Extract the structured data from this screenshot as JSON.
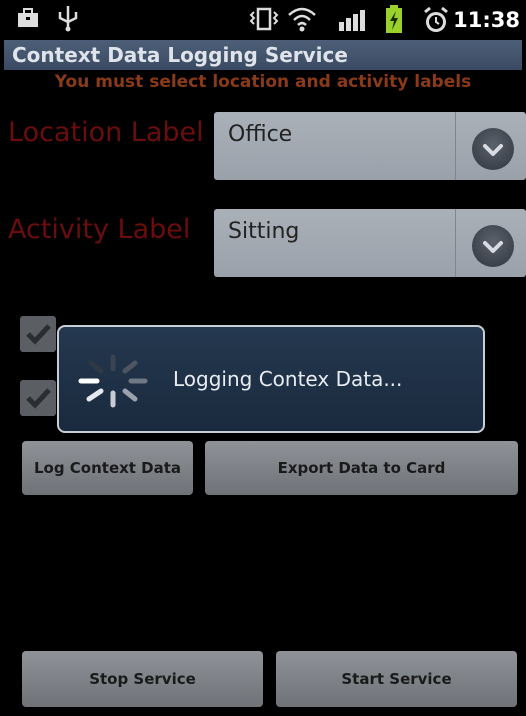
{
  "status_bar": {
    "time": "11:38"
  },
  "app_title": "Context Data Logging Service",
  "warning": "You must select location and activity labels",
  "location": {
    "label": "Location Label",
    "value": "Office"
  },
  "activity": {
    "label": "Activity Label",
    "value": "Sitting"
  },
  "checkboxes": [
    {
      "checked": true
    },
    {
      "checked": true
    }
  ],
  "buttons": {
    "log": "Log Context Data",
    "export": "Export Data to Card",
    "stop": "Stop Service",
    "start": "Start Service"
  },
  "dialog": {
    "message": "Logging Contex Data..."
  }
}
